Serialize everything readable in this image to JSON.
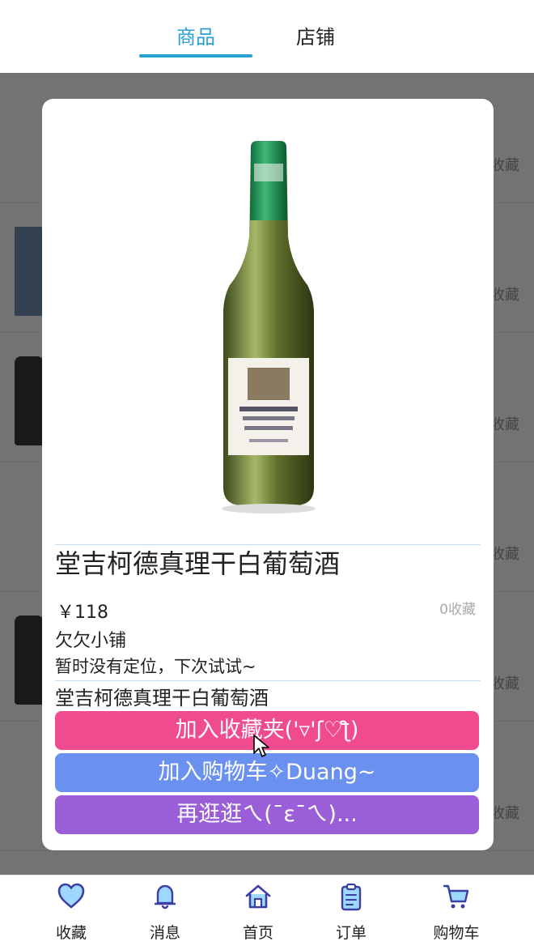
{
  "tabs": [
    {
      "label": "商品",
      "active": true
    },
    {
      "label": "店铺",
      "active": false
    }
  ],
  "background_list": {
    "fav_label": "收藏"
  },
  "product": {
    "title": "堂吉柯德真理干白葡萄酒",
    "price": "￥118",
    "favorite_count": "0收藏",
    "shop_name": "欠欠小铺",
    "location": "暂时没有定位，下次试试~",
    "description": "堂吉柯德真理干白葡萄酒"
  },
  "buttons": {
    "add_favorite": "加入收藏夹('▿'ʃ♡ƪ)",
    "add_cart": "加入购物车✧Duang~",
    "browse_more": "再逛逛ㄟ(¯ε¯ㄟ)..."
  },
  "bottom_nav": [
    {
      "label": "收藏",
      "icon": "heart-icon"
    },
    {
      "label": "消息",
      "icon": "bell-icon"
    },
    {
      "label": "首页",
      "icon": "home-icon"
    },
    {
      "label": "订单",
      "icon": "clipboard-icon"
    },
    {
      "label": "购物车",
      "icon": "cart-icon"
    }
  ],
  "colors": {
    "accent": "#2a9fd8",
    "favorite_button": "#f14b8f",
    "cart_button": "#6a90f0",
    "browse_button": "#9a5ed8"
  }
}
